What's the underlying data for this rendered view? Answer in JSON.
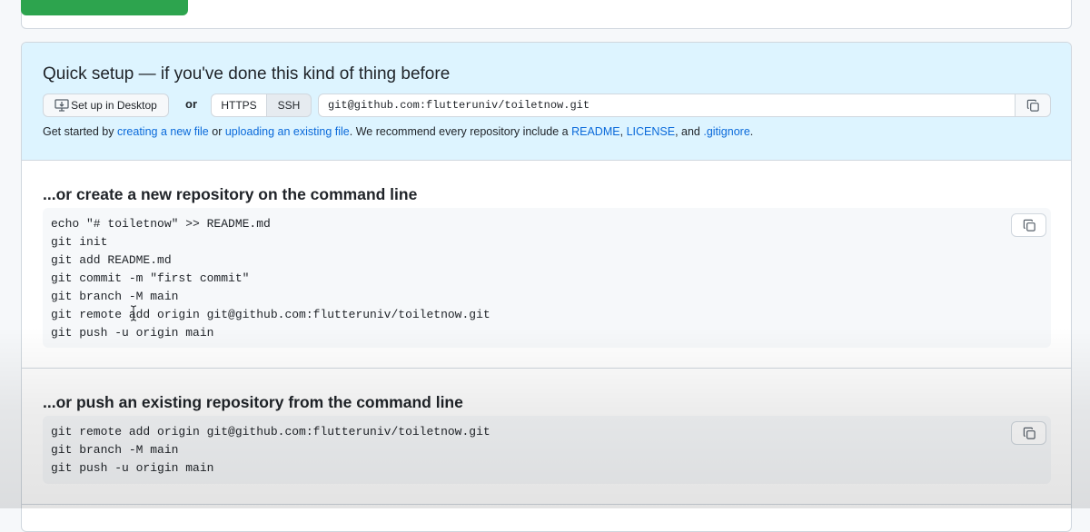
{
  "colors": {
    "quick_setup_bg": "#ddf4ff",
    "link": "#0969da",
    "primary_button": "#2da44e",
    "code_bg": "#f6f8fa",
    "border": "#d0d7de"
  },
  "quick_setup": {
    "title": "Quick setup — if you've done this kind of thing before",
    "desktop_button": {
      "label": "Set up in Desktop",
      "icon": "desktop-download-icon"
    },
    "or_label": "or",
    "protocols": [
      {
        "label": "HTTPS",
        "selected": false
      },
      {
        "label": "SSH",
        "selected": true
      }
    ],
    "clone_url": "git@github.com:flutteruniv/toiletnow.git",
    "copy_icon": "copy-icon",
    "help": {
      "prefix": "Get started by",
      "link_create": "creating a new file",
      "or": "or",
      "link_upload": "uploading an existing file",
      "middle": ". We recommend every repository include a",
      "link_readme": "README",
      "comma": ",",
      "link_license": "LICENSE",
      "and": ", and",
      "link_gitignore": ".gitignore",
      "suffix": "."
    }
  },
  "create_section": {
    "title": "...or create a new repository on the command line",
    "lines": [
      "echo \"# toiletnow\" >> README.md",
      "git init",
      "git add README.md",
      "git commit -m \"first commit\"",
      "git branch -M main",
      "git remote add origin git@github.com:flutteruniv/toiletnow.git",
      "git push -u origin main"
    ]
  },
  "push_section": {
    "title": "...or push an existing repository from the command line",
    "lines": [
      "git remote add origin git@github.com:flutteruniv/toiletnow.git",
      "git branch -M main",
      "git push -u origin main"
    ]
  }
}
